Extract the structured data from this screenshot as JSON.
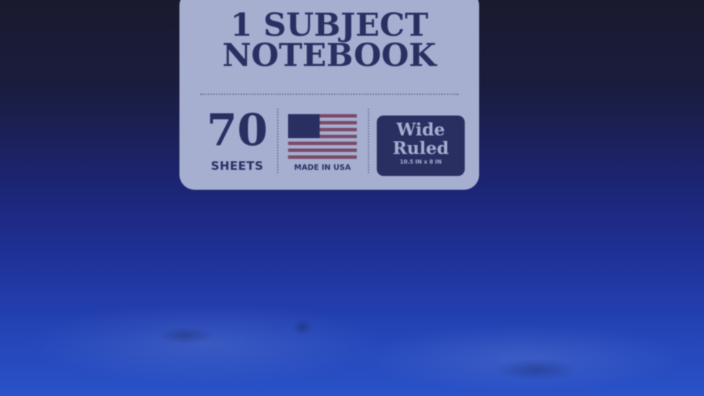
{
  "label": {
    "title_line1": "1 SUBJECT",
    "title_line2": "NOTEBOOK",
    "sheet_count": "70",
    "sheet_unit": "SHEETS",
    "origin": "MADE IN USA",
    "ruling_line1": "Wide",
    "ruling_line2": "Ruled",
    "ruling_size": "10.5 IN x 8 IN",
    "flag_icon": "us-flag-icon"
  },
  "colors": {
    "label_background": "#a6afd0",
    "label_ink": "#2a2f62",
    "cover_dark": "#1a1a2e",
    "cover_blue": "#2a52c8"
  }
}
